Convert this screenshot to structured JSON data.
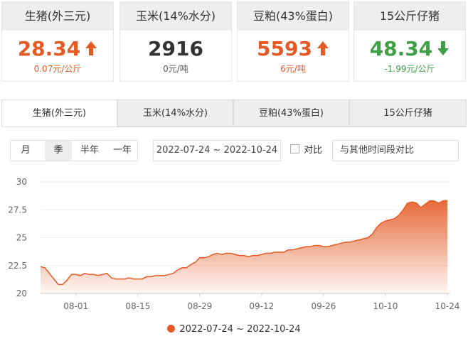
{
  "cards": [
    {
      "title": "生猪(外三元)",
      "value": "28.34",
      "change": "0.07元/公斤",
      "trend": "up",
      "active": true
    },
    {
      "title": "玉米(14%水分)",
      "value": "2916",
      "change": "0元/吨",
      "trend": "flat",
      "active": false
    },
    {
      "title": "豆粕(43%蛋白)",
      "value": "5593",
      "change": "6元/吨",
      "trend": "up",
      "active": false
    },
    {
      "title": "15公斤仔猪",
      "value": "48.34",
      "change": "-1.99元/公斤",
      "trend": "down",
      "active": false
    }
  ],
  "tabs": [
    "生猪(外三元)",
    "玉米(14%水分)",
    "豆粕(43%蛋白)",
    "15公斤仔猪"
  ],
  "period_options": [
    "月",
    "季",
    "半年",
    "一年"
  ],
  "selected_period": "季",
  "date_range": "2022-07-24 ~ 2022-10-24",
  "compare_label": "对比",
  "compare_placeholder": "与其他时间段对比",
  "colors": {
    "up": "#e55a24",
    "down": "#3fa046",
    "accent_border": "#3fae5a",
    "series": "#e55a24"
  },
  "icons": {
    "up": "arrow-up-icon",
    "down": "arrow-down-icon"
  },
  "chart_data": {
    "type": "area",
    "title": "",
    "xlabel": "",
    "ylabel": "",
    "ylim": [
      20,
      30
    ],
    "yticks": [
      "20",
      "22.5",
      "25",
      "27.5",
      "30"
    ],
    "xticks": [
      "08-01",
      "08-15",
      "08-29",
      "09-12",
      "09-26",
      "10-10",
      "10-24"
    ],
    "grid": true,
    "legend": "bottom-center",
    "series": [
      {
        "name": "2022-07-24 ~ 2022-10-24",
        "x": [
          "07-24",
          "07-25",
          "07-26",
          "07-27",
          "07-28",
          "07-29",
          "07-30",
          "07-31",
          "08-01",
          "08-02",
          "08-03",
          "08-04",
          "08-05",
          "08-06",
          "08-07",
          "08-08",
          "08-09",
          "08-10",
          "08-11",
          "08-12",
          "08-13",
          "08-14",
          "08-15",
          "08-16",
          "08-17",
          "08-18",
          "08-19",
          "08-20",
          "08-21",
          "08-22",
          "08-23",
          "08-24",
          "08-25",
          "08-26",
          "08-27",
          "08-28",
          "08-29",
          "08-30",
          "08-31",
          "09-01",
          "09-02",
          "09-03",
          "09-04",
          "09-05",
          "09-06",
          "09-07",
          "09-08",
          "09-09",
          "09-10",
          "09-11",
          "09-12",
          "09-13",
          "09-14",
          "09-15",
          "09-16",
          "09-17",
          "09-18",
          "09-19",
          "09-20",
          "09-21",
          "09-22",
          "09-23",
          "09-24",
          "09-25",
          "09-26",
          "09-27",
          "09-28",
          "09-29",
          "09-30",
          "10-01",
          "10-02",
          "10-03",
          "10-04",
          "10-05",
          "10-06",
          "10-07",
          "10-08",
          "10-09",
          "10-10",
          "10-11",
          "10-12",
          "10-13",
          "10-14",
          "10-15",
          "10-16",
          "10-17",
          "10-18",
          "10-19",
          "10-20",
          "10-21",
          "10-22",
          "10-23",
          "10-24"
        ],
        "values": [
          22.4,
          22.3,
          21.8,
          21.3,
          20.8,
          20.8,
          21.2,
          21.7,
          21.7,
          21.6,
          21.8,
          21.7,
          21.7,
          21.6,
          21.7,
          21.8,
          21.4,
          21.3,
          21.3,
          21.3,
          21.4,
          21.3,
          21.3,
          21.3,
          21.5,
          21.5,
          21.6,
          21.6,
          21.6,
          21.7,
          21.8,
          22.1,
          22.3,
          22.3,
          22.6,
          22.8,
          23.2,
          23.2,
          23.3,
          23.5,
          23.6,
          23.5,
          23.6,
          23.6,
          23.5,
          23.4,
          23.4,
          23.3,
          23.4,
          23.4,
          23.5,
          23.6,
          23.6,
          23.7,
          23.7,
          23.7,
          23.9,
          23.9,
          24.0,
          24.1,
          24.2,
          24.2,
          24.3,
          24.3,
          24.2,
          24.2,
          24.3,
          24.4,
          24.5,
          24.6,
          24.6,
          24.7,
          24.8,
          24.9,
          25.0,
          25.3,
          25.9,
          26.3,
          26.5,
          26.6,
          26.7,
          27.0,
          27.5,
          28.1,
          28.2,
          28.1,
          27.7,
          28.0,
          28.3,
          28.3,
          28.1,
          28.3,
          28.34
        ]
      }
    ]
  }
}
